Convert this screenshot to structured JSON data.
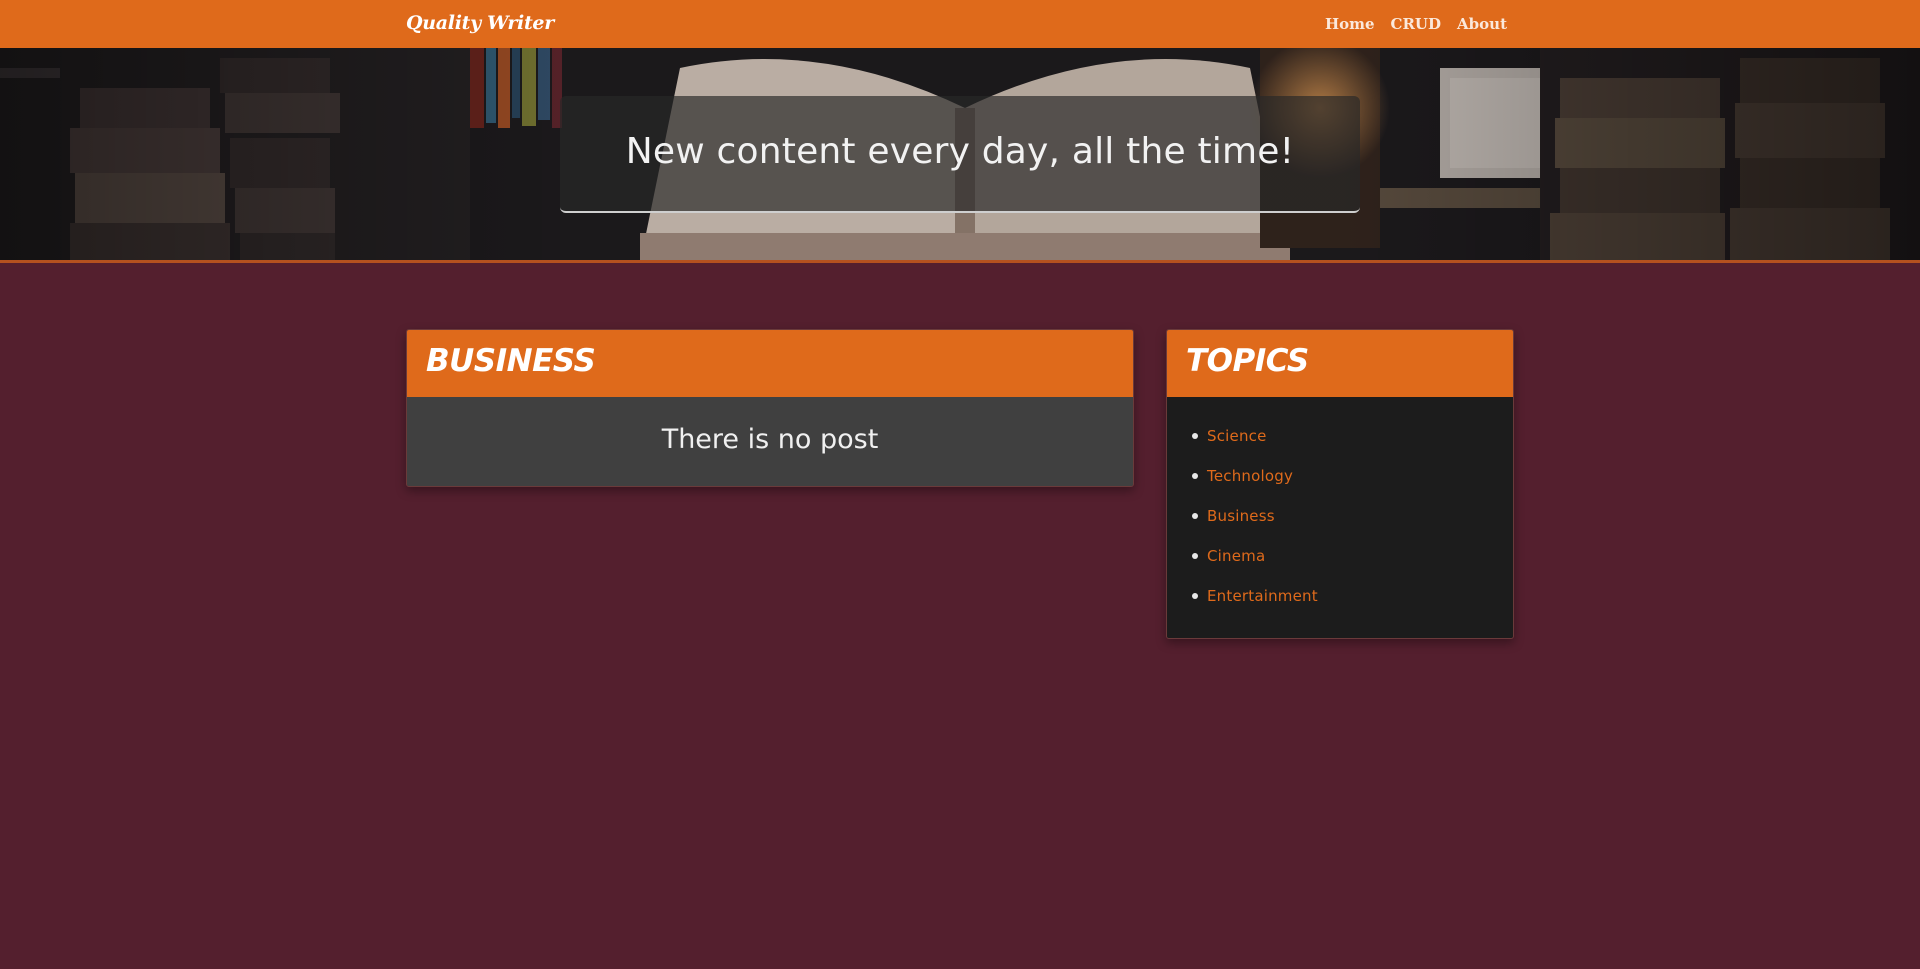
{
  "navbar": {
    "brand": "Quality Writer",
    "links": [
      "Home",
      "CRUD",
      "About"
    ]
  },
  "hero": {
    "headline": "New content every day, all the time!"
  },
  "main": {
    "category_title": "BUSINESS",
    "empty_message": "There is no post"
  },
  "sidebar": {
    "title": "TOPICS",
    "topics": [
      "Science",
      "Technology",
      "Business",
      "Cinema",
      "Entertainment"
    ]
  },
  "colors": {
    "accent": "#df6a1b",
    "page_background": "#541f2e",
    "card_body": "#404040",
    "sidebar_body": "#1c1c1c"
  },
  "icons": {
    "hero_background": "library-books-photo"
  }
}
